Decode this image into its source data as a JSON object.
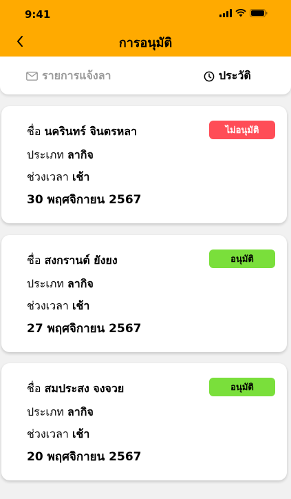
{
  "status_bar": {
    "time": "9:41"
  },
  "header": {
    "title": "การอนุมัติ",
    "bg_color": "#FFAA00"
  },
  "tabs": [
    {
      "label": "รายการแจ้งลา",
      "icon": "mail-icon",
      "active": false
    },
    {
      "label": "ประวัติ",
      "icon": "clock-icon",
      "active": true
    }
  ],
  "labels": {
    "name": "ชื่อ",
    "type": "ประเภท",
    "period": "ช่วงเวลา"
  },
  "status_colors": {
    "rejected": "#FF4D57",
    "approved": "#7ADF3B"
  },
  "requests": [
    {
      "name": "นครินทร์ จินตรหลา",
      "type": "ลากิจ",
      "period": "เช้า",
      "date": "30 พฤศจิกายน 2567",
      "status": "ไม่อนุมัติ",
      "status_key": "rejected"
    },
    {
      "name": "สงกรานต์ ยังยง",
      "type": "ลากิจ",
      "period": "เช้า",
      "date": "27 พฤศจิกายน 2567",
      "status": "อนุมัติ",
      "status_key": "approved"
    },
    {
      "name": "สมประสง จงจวย",
      "type": "ลากิจ",
      "period": "เช้า",
      "date": "20 พฤศจิกายน 2567",
      "status": "อนุมัติ",
      "status_key": "approved"
    }
  ]
}
